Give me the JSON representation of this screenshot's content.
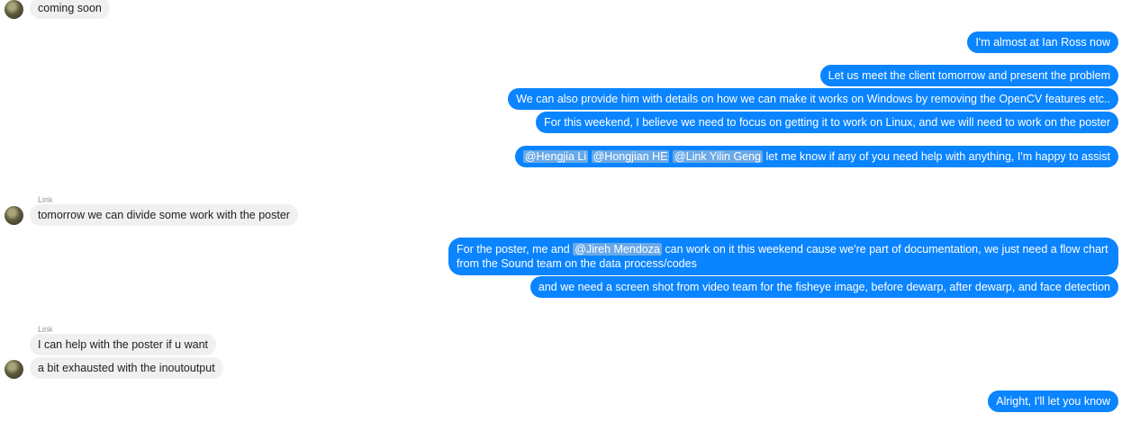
{
  "messages": {
    "m1": "coming soon",
    "m2": "I'm almost at Ian Ross now",
    "m3": "Let us meet the client tomorrow and present the problem",
    "m4": "We can also provide him with details on how we can make it works on Windows by removing the OpenCV features etc..",
    "m5": "For this weekend, I believe we need to focus on getting it to work on Linux, and we will need to work on the poster",
    "m6": {
      "mention1": "@Hengjia Li",
      "mention2": "@Hongjian HE",
      "mention3": "@Link Yilin Geng",
      "text": "let me know if any of you need help with anything, I'm happy to assist"
    },
    "sender1": "Link",
    "m7": "tomorrow we can divide some work with the poster",
    "m8": {
      "pre": "For the poster, me and",
      "mention": "@Jireh Mendoza",
      "post": "can work on it this weekend cause we're part of documentation, we just need a flow chart from the Sound team on the data process/codes"
    },
    "m9": "and we need a screen shot from video team for the fisheye image, before dewarp, after dewarp, and face detection",
    "sender2": "Link",
    "m10": "I can help with the poster if u want",
    "m11": "a bit exhausted with the inoutoutput",
    "m12": "Alright, I'll let you know"
  },
  "colors": {
    "outgoing": "#0a84ff",
    "incoming": "#f1f0f0",
    "mention_highlight": "#6aa9e8"
  }
}
